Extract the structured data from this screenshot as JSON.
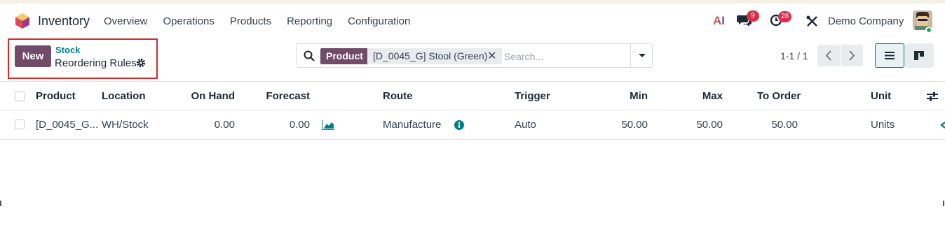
{
  "app": {
    "name": "Inventory"
  },
  "menu": [
    "Overview",
    "Operations",
    "Products",
    "Reporting",
    "Configuration"
  ],
  "systray": {
    "ai_label": "AI",
    "messages_count": "9",
    "activities_count": "28",
    "company": "Demo Company"
  },
  "control": {
    "new_label": "New",
    "breadcrumb_parent": "Stock",
    "breadcrumb_current": "Reordering Rules",
    "search": {
      "facet_label": "Product",
      "facet_value": "[D_0045_G] Stool (Green)",
      "placeholder": "Search..."
    },
    "pager": "1-1 / 1"
  },
  "table": {
    "columns": [
      "Product",
      "Location",
      "On Hand",
      "Forecast",
      "Route",
      "Trigger",
      "Min",
      "Max",
      "To Order",
      "Unit"
    ],
    "rows": [
      {
        "product": "[D_0045_G...",
        "location": "WH/Stock",
        "on_hand": "0.00",
        "forecast": "0.00",
        "route": "Manufacture",
        "trigger": "Auto",
        "min": "50.00",
        "max": "50.00",
        "to_order": "50.00",
        "unit": "Units"
      }
    ]
  },
  "colors": {
    "brand": "#714b67",
    "accent": "#017e84",
    "badge": "#d6304b",
    "highlight": "#d42a2a"
  }
}
